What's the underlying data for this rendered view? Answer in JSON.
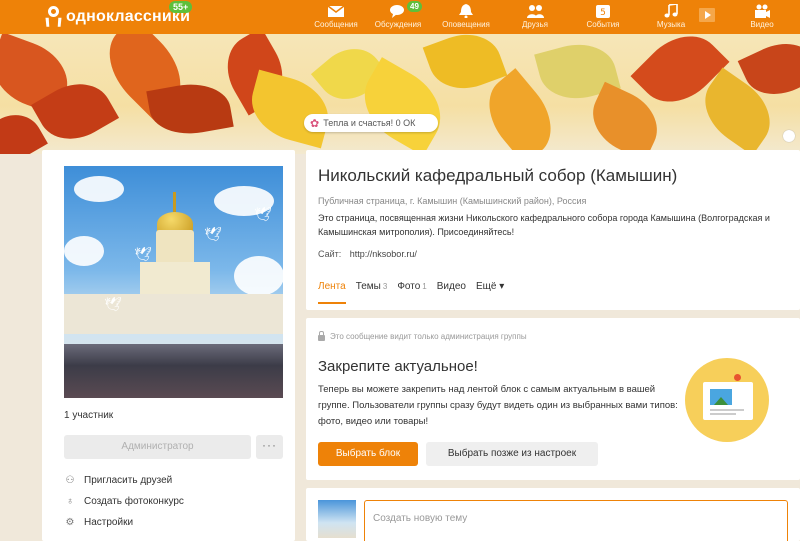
{
  "topbar": {
    "logo_text": "одноклассники",
    "logo_badge": "55+",
    "nav": [
      {
        "label": "Сообщения",
        "icon": "envelope-icon",
        "count": ""
      },
      {
        "label": "Обсуждения",
        "icon": "chat-bubbles-icon",
        "count": "49"
      },
      {
        "label": "Оповещения",
        "icon": "bell-icon",
        "count": ""
      },
      {
        "label": "Друзья",
        "icon": "friends-icon",
        "count": ""
      },
      {
        "label": "События",
        "icon": "events-icon",
        "count": ""
      },
      {
        "label": "Музыка",
        "icon": "music-note-icon",
        "count": ""
      },
      {
        "label": "Видео",
        "icon": "video-camera-icon",
        "count": ""
      }
    ]
  },
  "banner": {
    "pill_text": "Тепла и счастья! 0 ОК"
  },
  "left": {
    "members": "1 участник",
    "admin_button": "Администратор",
    "more_button": "···",
    "menu": [
      {
        "label": "Пригласить друзей",
        "icon": "invite-friends-icon"
      },
      {
        "label": "Создать фотоконкурс",
        "icon": "photo-contest-icon"
      },
      {
        "label": "Настройки",
        "icon": "gear-icon"
      }
    ]
  },
  "group": {
    "title": "Никольский кафедральный собор (Камышин)",
    "meta": "Публичная страница, г. Камышин (Камышинский район), Россия",
    "description": "Это страница, посвященная жизни Никольского кафедрального собора города Камышина (Волгоградская и Камышинская митрополия). Присоединяйтесь!",
    "site_label": "Сайт:",
    "site_url": "http://nksobor.ru/",
    "tabs": [
      {
        "label": "Лента",
        "count": "",
        "active": true
      },
      {
        "label": "Темы",
        "count": "3",
        "active": false
      },
      {
        "label": "Фото",
        "count": "1",
        "active": false
      },
      {
        "label": "Видео",
        "count": "",
        "active": false
      },
      {
        "label": "Ещё ▾",
        "count": "",
        "active": false
      }
    ]
  },
  "pin": {
    "admin_note": "Это сообщение видит только администрация группы",
    "heading": "Закрепите актуальное!",
    "text": "Теперь вы можете закрепить над лентой блок с самым актуальным в вашей группе. Пользователи группы сразу будут видеть один из выбранных вами типов: фото, видео или товары!",
    "primary_button": "Выбрать блок",
    "secondary_button": "Выбрать позже из настроек"
  },
  "topic": {
    "placeholder": "Создать новую тему"
  },
  "colors": {
    "accent": "#ee8208",
    "badge_green": "#5fbf3a"
  }
}
